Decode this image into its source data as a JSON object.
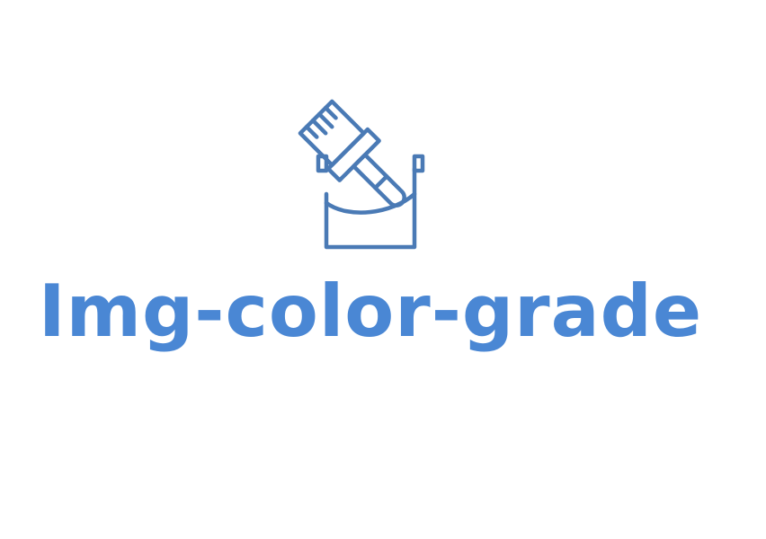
{
  "logo": {
    "title": "Img-color-grade",
    "icon": "paint-bucket-brush-icon",
    "colors": {
      "icon": "#4a7ab5",
      "text": "#4a87d4",
      "background": "#ffffff"
    }
  }
}
